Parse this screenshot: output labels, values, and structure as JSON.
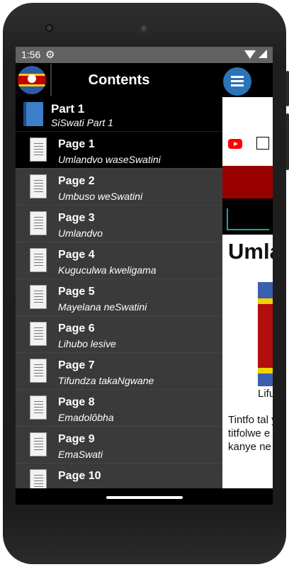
{
  "status": {
    "time": "1:56",
    "settings_icon": "gear-icon",
    "wifi_icon": "wifi-icon",
    "signal_icon": "signal-icon"
  },
  "drawer": {
    "title": "Contents",
    "logo_icon": "eswatini-flag-icon",
    "part": {
      "title": "Part 1",
      "subtitle": "SiSwati Part 1",
      "icon": "book-icon"
    },
    "pages": [
      {
        "title": "Page 1",
        "subtitle": "Umlandvo waseSwatini",
        "icon": "document-icon"
      },
      {
        "title": "Page 2",
        "subtitle": "Umbuso weSwatini",
        "icon": "document-icon"
      },
      {
        "title": "Page 3",
        "subtitle": "Umlandvo",
        "icon": "document-icon"
      },
      {
        "title": "Page 4",
        "subtitle": "Kuguculwa kweligama",
        "icon": "document-icon"
      },
      {
        "title": "Page 5",
        "subtitle": "Mayelana neSwatini",
        "icon": "document-icon"
      },
      {
        "title": "Page 6",
        "subtitle": "Lihubo lesive",
        "icon": "document-icon"
      },
      {
        "title": "Page 7",
        "subtitle": "Tifundza takaNgwane",
        "icon": "document-icon"
      },
      {
        "title": "Page 8",
        "subtitle": "Emadolôbha",
        "icon": "document-icon"
      },
      {
        "title": "Page 9",
        "subtitle": "EmaSwati",
        "icon": "document-icon"
      },
      {
        "title": "Page 10",
        "subtitle": "",
        "icon": "document-icon"
      }
    ]
  },
  "background": {
    "article_title_visible": "Umla",
    "flag_caption_visible": "Lifu",
    "body_visible": "Tintfo tal yebantfu titfolwe e tekucala kanye ne Naokuba"
  },
  "colors": {
    "drawer_bg": "#3a3a3a",
    "header_bg": "#000000",
    "accent_blue": "#2a74b8",
    "statusbar_bg": "#626262"
  }
}
